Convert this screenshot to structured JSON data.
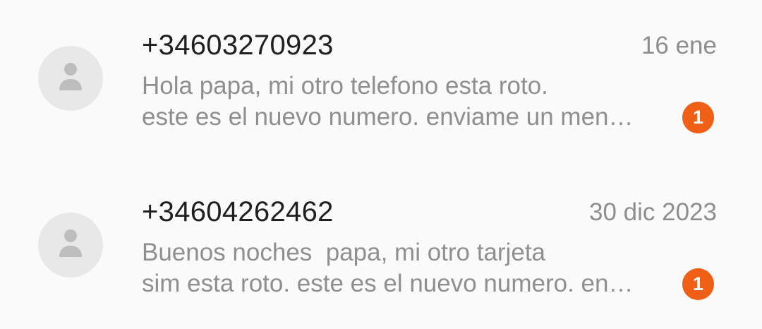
{
  "threads": [
    {
      "sender": "+34603270923",
      "date": "16 ene",
      "preview_line1": "Hola papa, mi otro telefono esta roto.",
      "preview_line2": "este es el nuevo numero. enviame un men…",
      "unread_count": "1",
      "avatar_icon": "person-placeholder-icon"
    },
    {
      "sender": "+34604262462",
      "date": "30 dic 2023",
      "preview_line1": "Buenos noches  papa, mi otro tarjeta",
      "preview_line2": "sim esta roto. este es el nuevo numero. en…",
      "unread_count": "1",
      "avatar_icon": "person-placeholder-icon"
    }
  ],
  "colors": {
    "background": "#fafafa",
    "avatar_bg": "#e8e8e8",
    "avatar_fg": "#bdbdbd",
    "badge": "#ef5f16",
    "sender_text": "#1f1f1f",
    "secondary_text": "#8f8f8f"
  }
}
